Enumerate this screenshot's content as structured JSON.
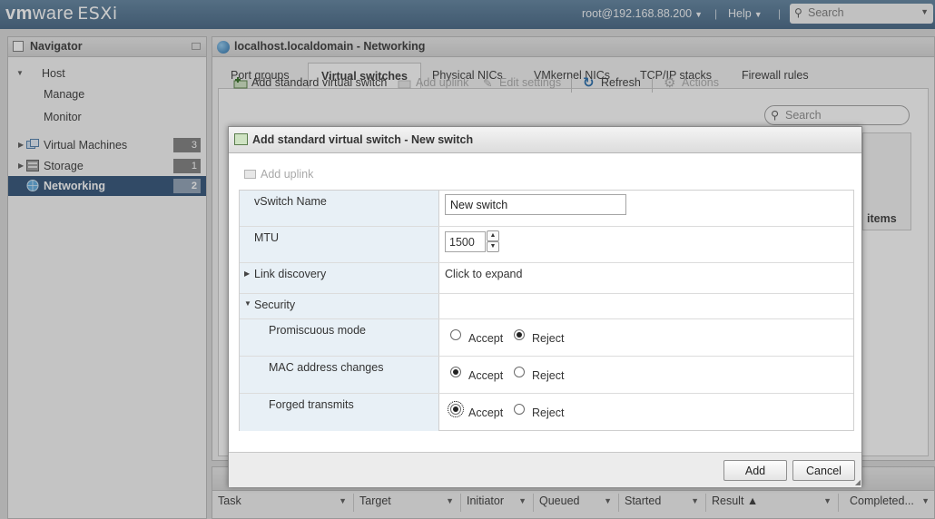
{
  "topbar": {
    "brand_vm": "vm",
    "brand_ware": "ware",
    "brand_product": "ESXi",
    "user": "root@192.168.88.200",
    "help": "Help",
    "search_placeholder": "Search"
  },
  "navigator": {
    "title": "Navigator",
    "host": "Host",
    "manage": "Manage",
    "monitor": "Monitor",
    "items": [
      {
        "label": "Virtual Machines",
        "count": "3",
        "icon": "virtual-machines-icon"
      },
      {
        "label": "Storage",
        "count": "1",
        "icon": "storage-icon"
      },
      {
        "label": "Networking",
        "count": "2",
        "icon": "networking-icon"
      }
    ]
  },
  "main": {
    "title": "localhost.localdomain - Networking",
    "tabs": [
      "Port groups",
      "Virtual switches",
      "Physical NICs",
      "VMkernel NICs",
      "TCP/IP stacks",
      "Firewall rules"
    ],
    "active_tab": "Virtual switches",
    "toolbar": {
      "add_switch": "Add standard virtual switch",
      "add_uplink": "Add uplink",
      "edit_settings": "Edit settings",
      "refresh": "Refresh",
      "actions": "Actions",
      "search_placeholder": "Search"
    },
    "items_label": "items"
  },
  "tasks": {
    "columns": [
      "Task",
      "Target",
      "Initiator",
      "Queued",
      "Started",
      "Result ▲",
      "Completed..."
    ]
  },
  "dialog": {
    "title": "Add standard virtual switch - New switch",
    "add_uplink": "Add uplink",
    "fields": {
      "vswitch_name_label": "vSwitch Name",
      "vswitch_name_value": "New switch",
      "mtu_label": "MTU",
      "mtu_value": "1500",
      "link_discovery_label": "Link discovery",
      "link_discovery_value": "Click to expand",
      "security_label": "Security",
      "promiscuous_label": "Promiscuous mode",
      "mac_label": "MAC address changes",
      "forged_label": "Forged transmits",
      "accept": "Accept",
      "reject": "Reject"
    },
    "selected": {
      "promiscuous_mode": "Reject",
      "mac_address_changes": "Accept",
      "forged_transmits": "Accept"
    },
    "buttons": {
      "add": "Add",
      "cancel": "Cancel"
    }
  }
}
